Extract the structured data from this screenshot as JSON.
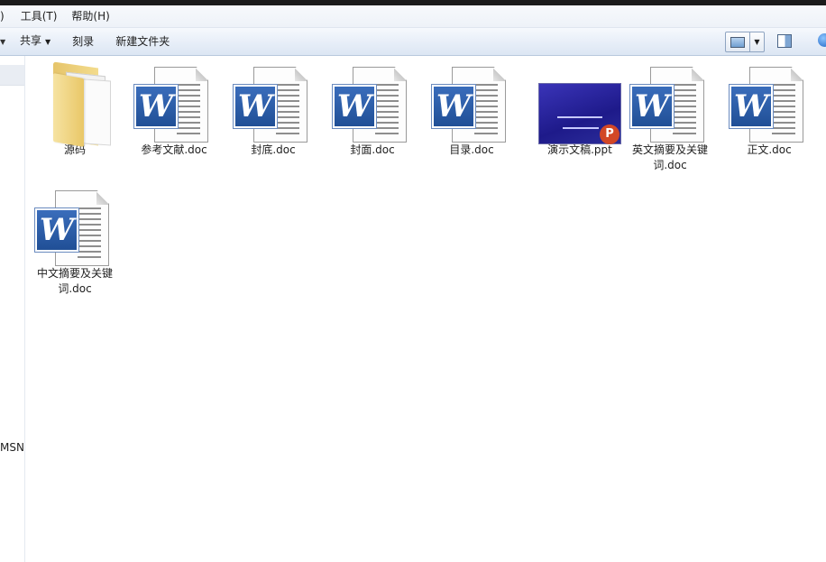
{
  "menubar": {
    "items": [
      ")",
      "工具(T)",
      "帮助(H)"
    ]
  },
  "toolbar": {
    "share_label": "共享",
    "burn_label": "刻录",
    "new_folder_label": "新建文件夹"
  },
  "navpane": {
    "msn_label": "MSN"
  },
  "files": [
    {
      "name": "源码",
      "type": "folder"
    },
    {
      "name": "参考文献.doc",
      "type": "doc"
    },
    {
      "name": "封底.doc",
      "type": "doc"
    },
    {
      "name": "封面.doc",
      "type": "doc"
    },
    {
      "name": "目录.doc",
      "type": "doc"
    },
    {
      "name": "演示文稿.ppt",
      "type": "ppt"
    },
    {
      "name": "英文摘要及关键词.doc",
      "type": "doc"
    },
    {
      "name": "正文.doc",
      "type": "doc"
    },
    {
      "name": "中文摘要及关键词.doc",
      "type": "doc"
    }
  ],
  "colors": {
    "word_blue": "#2b5797",
    "ppt_orange": "#d24726",
    "folder_yellow": "#eccf7a"
  },
  "icons": {
    "word": "word-document-icon",
    "folder": "folder-icon",
    "ppt": "powerpoint-icon"
  }
}
